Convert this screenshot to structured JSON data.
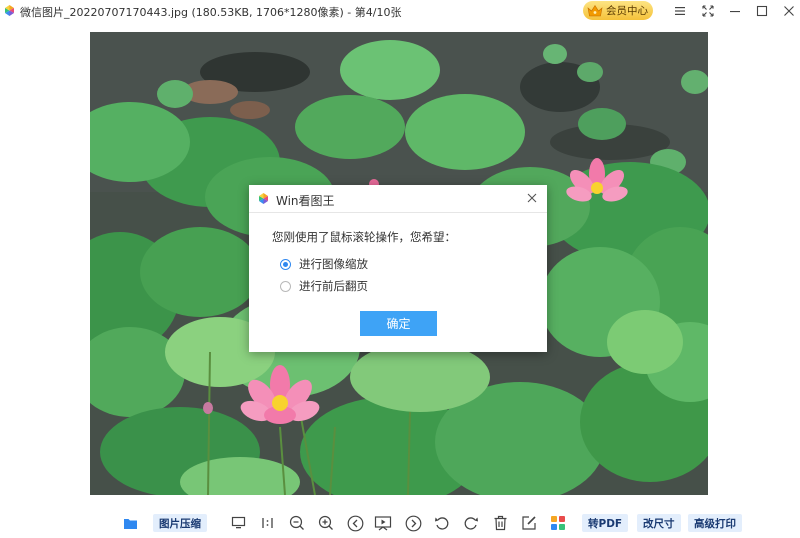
{
  "window": {
    "title": "微信图片_20220707170443.jpg (180.53KB, 1706*1280像素) - 第4/10张",
    "vip_label": "会员中心",
    "controls": [
      "menu",
      "fullscreen",
      "minimize",
      "maximize",
      "close"
    ]
  },
  "image": {
    "subject": "lotus pond photo"
  },
  "dialog": {
    "title": "Win看图王",
    "message": "您刚使用了鼠标滚轮操作，您希望：",
    "options": [
      {
        "label": "进行图像缩放",
        "checked": true
      },
      {
        "label": "进行前后翻页",
        "checked": false
      }
    ],
    "ok_label": "确定"
  },
  "toolbar": {
    "compress_label": "图片压缩",
    "pdf_label": "转PDF",
    "resize_label": "改尺寸",
    "print_label": "高级打印",
    "icons": [
      "folder-icon",
      "monitor-icon",
      "actual-size-icon",
      "zoom-out-icon",
      "zoom-in-icon",
      "prev-icon",
      "slideshow-icon",
      "next-icon",
      "rotate-left-icon",
      "rotate-right-icon",
      "delete-icon",
      "edit-icon",
      "apps-icon"
    ]
  },
  "colors": {
    "accent": "#3ea3f6",
    "vip": "#f5c23a",
    "toolbar_button_bg": "#e3eefc"
  }
}
